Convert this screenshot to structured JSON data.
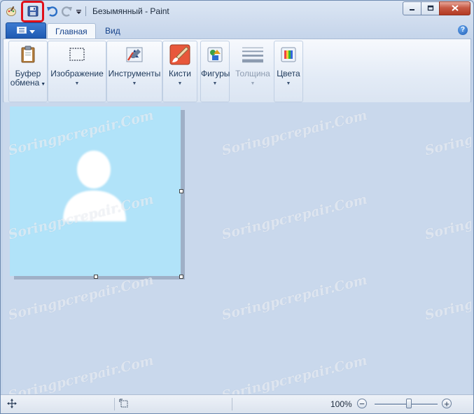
{
  "window": {
    "title": "Безымянный - Paint",
    "controls": {
      "minimize_icon": "minimize-icon",
      "maximize_icon": "maximize-icon",
      "close_icon": "close-icon"
    }
  },
  "quick_access": {
    "icons": [
      "paint-app-icon",
      "save-icon",
      "undo-icon",
      "redo-icon",
      "customize-dropdown-icon"
    ],
    "highlight_color": "#e0101a"
  },
  "tabs": [
    {
      "label": "Главная",
      "active": true
    },
    {
      "label": "Вид",
      "active": false
    }
  ],
  "ribbon_groups": [
    {
      "label_line1": "Буфер",
      "label_line2": "обмена",
      "icon": "clipboard-icon"
    },
    {
      "label_line1": "Изображение",
      "icon": "select-icon"
    },
    {
      "label_line1": "Инструменты",
      "icon": "tools-icon"
    },
    {
      "label_line1": "Кисти",
      "icon": "brush-icon"
    },
    {
      "label_line1": "Фигуры",
      "icon": "shapes-icon"
    },
    {
      "label_line1": "Толщина",
      "icon": "line-width-icon",
      "disabled": true
    },
    {
      "label_line1": "Цвета",
      "icon": "colors-icon"
    }
  ],
  "canvas": {
    "background": "#b1e3f9",
    "figure_color": "#ffffff",
    "area_color": "#c9d8ec"
  },
  "watermark": {
    "text": "Soringpcrepair.Com"
  },
  "statusbar": {
    "zoom_level": "100%",
    "zoom_minus": "−",
    "zoom_plus": "+",
    "zoom_value_percent": 100
  }
}
